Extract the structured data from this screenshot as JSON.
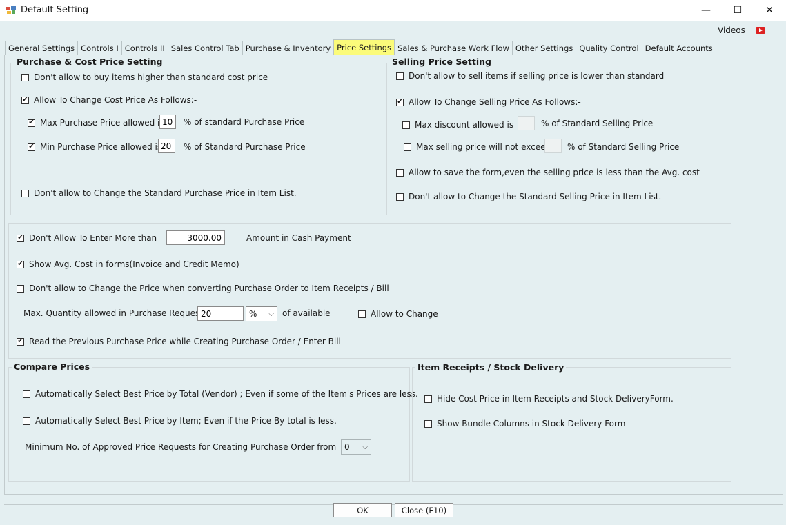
{
  "window": {
    "title": "Default Setting",
    "minimize": "—",
    "maximize": "☐",
    "close": "✕"
  },
  "videos_label": "Videos",
  "tabs": [
    {
      "label": "General Settings"
    },
    {
      "label": "Controls I"
    },
    {
      "label": "Controls II"
    },
    {
      "label": "Sales Control Tab"
    },
    {
      "label": "Purchase & Inventory"
    },
    {
      "label": "Price Settings"
    },
    {
      "label": "Sales & Purchase Work Flow"
    },
    {
      "label": "Other Settings"
    },
    {
      "label": "Quality Control"
    },
    {
      "label": "Default Accounts"
    }
  ],
  "purchase": {
    "title": "Purchase & Cost Price Setting",
    "no_buy_higher": "Don't allow to buy items higher than standard cost price",
    "allow_change": "Allow To Change Cost Price As Follows:-",
    "max_label": "Max Purchase Price allowed  is",
    "max_value": "10",
    "max_suffix": "% of standard Purchase Price",
    "min_label": "Min Purchase Price allowed is",
    "min_value": "20",
    "min_suffix": "% of Standard Purchase Price",
    "no_change_std": "Don't allow to Change the Standard Purchase Price in Item List."
  },
  "selling": {
    "title": "Selling Price Setting",
    "no_sell_lower": "Don't allow to sell items if selling price is lower than standard",
    "allow_change": "Allow To Change Selling Price As Follows:-",
    "max_discount": "Max discount allowed is",
    "max_discount_suffix": "% of Standard Selling Price",
    "max_selling": "Max selling price will not exceed",
    "max_selling_suffix": "% of Standard Selling Price",
    "allow_save": "Allow to save the form,even the selling price is less than the Avg. cost",
    "no_change_std": "Don't allow to Change the Standard Selling Price in Item List."
  },
  "general": {
    "cash_label": "Don't Allow To Enter More than",
    "cash_value": "3000.00",
    "cash_suffix": "Amount in Cash Payment",
    "show_avg": "Show Avg. Cost in forms(Invoice and Credit Memo)",
    "no_change_po": "Don't allow to Change the Price when converting Purchase Order to Item Receipts / Bill",
    "max_qty_label": "Max. Quantity allowed in Purchase Request",
    "max_qty_value": "20",
    "max_qty_unit": "%",
    "of_available": "of available",
    "allow_to_change": "Allow to Change",
    "read_prev": "Read the Previous Purchase Price while Creating Purchase Order / Enter Bill"
  },
  "compare": {
    "title": "Compare Prices",
    "auto_total": "Automatically Select Best Price by Total (Vendor) ; Even if some of the Item's Prices are less.",
    "auto_item": "Automatically Select Best Price by Item; Even if the Price By total is less.",
    "min_requests_label": "Minimum No. of Approved Price Requests for Creating Purchase Order from",
    "min_requests_value": "0"
  },
  "receipts": {
    "title": "Item Receipts / Stock Delivery",
    "hide_cost": "Hide Cost Price in Item Receipts and Stock DeliveryForm.",
    "show_bundle": "Show Bundle Columns in Stock Delivery Form"
  },
  "buttons": {
    "ok": "OK",
    "close": "Close (F10)"
  },
  "checks": {
    "check_mark": "✔"
  },
  "colors": {
    "background": "#e4eff1",
    "active_tab": "#fbfb7a",
    "youtube": "#dd2222"
  }
}
